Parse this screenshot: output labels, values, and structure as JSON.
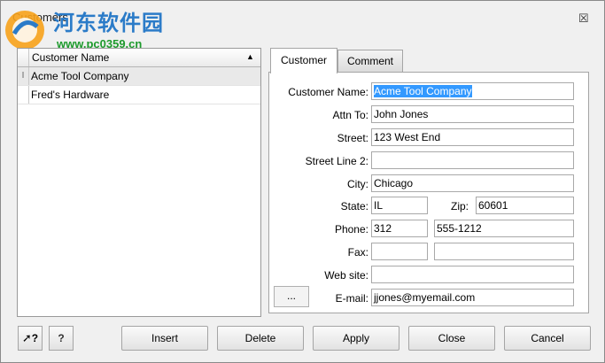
{
  "window": {
    "title": "Customers",
    "close_glyph": "☒"
  },
  "watermark": {
    "line1": "河东软件园",
    "line2": "www.pc0359.cn"
  },
  "grid": {
    "column": "Customer Name",
    "sort_glyph": "▲",
    "rows": [
      {
        "indicator": "I",
        "name": "Acme Tool Company"
      },
      {
        "indicator": "",
        "name": "Fred's Hardware"
      }
    ]
  },
  "tabs": {
    "customer": "Customer",
    "comment": "Comment"
  },
  "form": {
    "customer_name_label": "Customer Name:",
    "customer_name": "Acme Tool Company",
    "attn_label": "Attn To:",
    "attn": "John Jones",
    "street_label": "Street:",
    "street": "123 West End",
    "street2_label": "Street Line 2:",
    "street2": "",
    "city_label": "City:",
    "city": "Chicago",
    "state_label": "State:",
    "state": "IL",
    "zip_label": "Zip:",
    "zip": "60601",
    "phone_label": "Phone:",
    "phone_area": "312",
    "phone_number": "555-1212",
    "fax_label": "Fax:",
    "fax_area": "",
    "fax_number": "",
    "website_label": "Web site:",
    "website": "",
    "email_label": "E-mail:",
    "email": "jjones@myemail.com",
    "ellipsis": "..."
  },
  "buttons": {
    "insert": "Insert",
    "delete": "Delete",
    "apply": "Apply",
    "close": "Close",
    "cancel": "Cancel",
    "whats_this": "?",
    "help": "?"
  }
}
